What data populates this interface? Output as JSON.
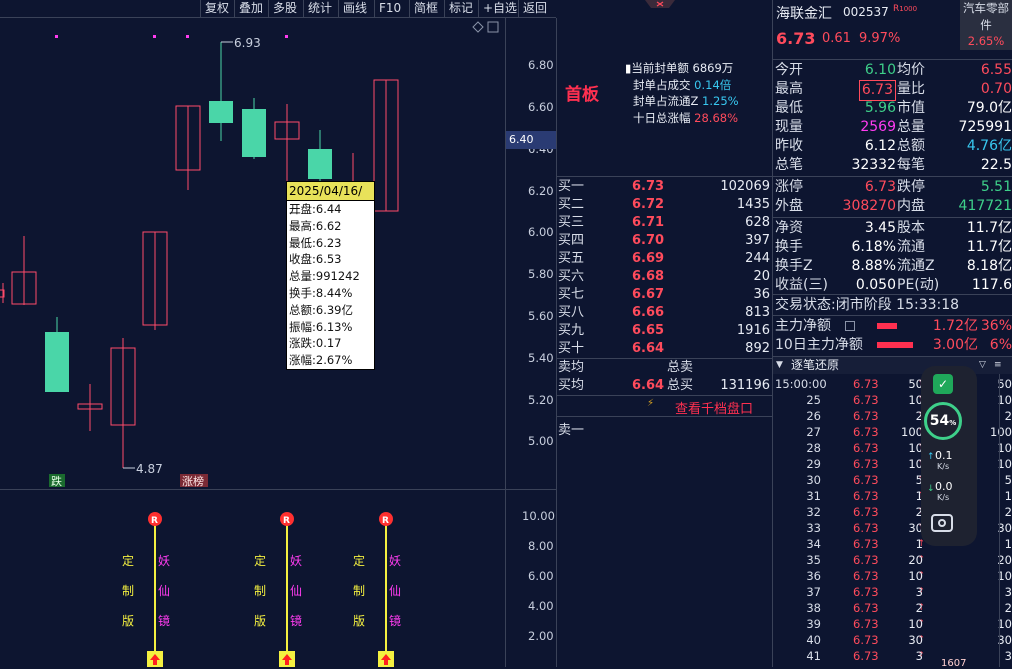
{
  "toolbar": {
    "items": [
      "复权",
      "叠加",
      "多股",
      "统计",
      "画线",
      "F10",
      "简框",
      "标记",
      "+自选",
      "返回"
    ]
  },
  "chart": {
    "high_label": "6.93",
    "low_label": "4.87",
    "price_axis": [
      "6.80",
      "6.60",
      "6.40",
      "6.20",
      "6.00",
      "5.80",
      "5.60",
      "5.40",
      "5.20",
      "5.00"
    ],
    "current_price_tag": "6.40",
    "badge_down": "跌",
    "badge_zhangting": "涨榜",
    "vol_axis": [
      "10.00",
      "8.00",
      "6.00",
      "4.00",
      "2.00"
    ],
    "indicator_marker": "R",
    "indicator_text_a": [
      "定",
      "制",
      "版"
    ],
    "indicator_text_b": [
      "妖",
      "仙",
      "镜"
    ],
    "colors": {
      "up": "#ff4b6a",
      "down": "#4ad6a8",
      "bg": "#0d1530",
      "grid": "#3a4258"
    }
  },
  "tooltip": {
    "date": "2025/04/16/三",
    "rows": [
      "开盘:6.44",
      "最高:6.62",
      "最低:6.23",
      "收盘:6.53",
      "总量:991242",
      "换手:8.44%",
      "总额:6.39亿",
      "振幅:6.13%",
      "涨跌:0.17",
      "涨幅:2.67%"
    ]
  },
  "board": {
    "title": "首板",
    "stats": [
      {
        "label": "当前封单额",
        "value": "6869万"
      },
      {
        "label": "封单占成交",
        "value": "0.14倍"
      },
      {
        "label": "封单占流通Z",
        "value": "1.25%"
      },
      {
        "label": "十日总涨幅",
        "value": "28.68%"
      }
    ]
  },
  "orderbook": {
    "bids": [
      {
        "label": "买一",
        "price": "6.73",
        "vol": "102069"
      },
      {
        "label": "买二",
        "price": "6.72",
        "vol": "1435"
      },
      {
        "label": "买三",
        "price": "6.71",
        "vol": "628"
      },
      {
        "label": "买四",
        "price": "6.70",
        "vol": "397"
      },
      {
        "label": "买五",
        "price": "6.69",
        "vol": "244"
      },
      {
        "label": "买六",
        "price": "6.68",
        "vol": "20"
      },
      {
        "label": "买七",
        "price": "6.67",
        "vol": "36"
      },
      {
        "label": "买八",
        "price": "6.66",
        "vol": "813"
      },
      {
        "label": "买九",
        "price": "6.65",
        "vol": "1916"
      },
      {
        "label": "买十",
        "price": "6.64",
        "vol": "892"
      }
    ],
    "sell_avg": "卖均",
    "total_sell": "总卖",
    "buy_avg": "买均",
    "buy_avg_price": "6.64",
    "total_buy": "总买",
    "total_buy_vol": "131196",
    "view_1000": "查看千档盘口",
    "ask1": "卖一"
  },
  "stock": {
    "name": "海联金汇",
    "code": "002537",
    "tag": "R",
    "tag2": "1000",
    "price": "6.73",
    "change": "0.61",
    "pct": "9.97%",
    "sector": "汽车零部件",
    "sector_pct": "2.65%"
  },
  "stats": [
    {
      "l1": "今开",
      "v1": "6.10",
      "c1": "green",
      "l2": "均价",
      "v2": "6.55",
      "c2": "red"
    },
    {
      "l1": "最高",
      "v1": "6.73",
      "c1": "red",
      "l2": "量比",
      "v2": "0.70",
      "c2": "red"
    },
    {
      "l1": "最低",
      "v1": "5.96",
      "c1": "green",
      "l2": "市值",
      "v2": "79.0亿",
      "c2": "white"
    },
    {
      "l1": "现量",
      "v1": "2569",
      "c1": "magenta",
      "l2": "总量",
      "v2": "725991",
      "c2": "white"
    },
    {
      "l1": "昨收",
      "v1": "6.12",
      "c1": "white",
      "l2": "总额",
      "v2": "4.76亿",
      "c2": "cyan"
    },
    {
      "l1": "总笔",
      "v1": "32332",
      "c1": "white",
      "l2": "每笔",
      "v2": "22.5",
      "c2": "white"
    },
    {
      "l1": "涨停",
      "v1": "6.73",
      "c1": "red",
      "l2": "跌停",
      "v2": "5.51",
      "c2": "green"
    },
    {
      "l1": "外盘",
      "v1": "308270",
      "c1": "red",
      "l2": "内盘",
      "v2": "417721",
      "c2": "green"
    },
    {
      "l1": "净资",
      "v1": "3.45",
      "c1": "white",
      "l2": "股本",
      "v2": "11.7亿",
      "c2": "white"
    },
    {
      "l1": "换手",
      "v1": "6.18%",
      "c1": "white",
      "l2": "流通",
      "v2": "11.7亿",
      "c2": "white"
    },
    {
      "l1": "换手Z",
      "v1": "8.88%",
      "c1": "white",
      "l2": "流通Z",
      "v2": "8.18亿",
      "c2": "white"
    },
    {
      "l1": "收益(三)",
      "v1": "0.050",
      "c1": "white",
      "l2": "PE(动)",
      "v2": "117.6",
      "c2": "white"
    }
  ],
  "status": {
    "label": "交易状态:",
    "value": "闭市阶段",
    "time": "15:33:18"
  },
  "netflow": [
    {
      "label": "主力净额",
      "value": "1.72亿",
      "pct": "36%"
    },
    {
      "label": "10日主力净额",
      "value": "3.00亿",
      "pct": "6%"
    }
  ],
  "ticks_title": "逐笔还原",
  "ticks": [
    {
      "t": "15:00:00",
      "p": "6.73",
      "v": "50"
    },
    {
      "t": "25",
      "p": "6.73",
      "v": "10"
    },
    {
      "t": "26",
      "p": "6.73",
      "v": "2"
    },
    {
      "t": "27",
      "p": "6.73",
      "v": "100"
    },
    {
      "t": "28",
      "p": "6.73",
      "v": "10"
    },
    {
      "t": "29",
      "p": "6.73",
      "v": "10"
    },
    {
      "t": "30",
      "p": "6.73",
      "v": "5"
    },
    {
      "t": "31",
      "p": "6.73",
      "v": "1"
    },
    {
      "t": "32",
      "p": "6.73",
      "v": "2"
    },
    {
      "t": "33",
      "p": "6.73",
      "v": "30"
    },
    {
      "t": "34",
      "p": "6.73",
      "v": "1"
    },
    {
      "t": "35",
      "p": "6.73",
      "v": "20"
    },
    {
      "t": "36",
      "p": "6.73",
      "v": "10"
    },
    {
      "t": "37",
      "p": "6.73",
      "v": "3"
    },
    {
      "t": "38",
      "p": "6.73",
      "v": "2"
    },
    {
      "t": "39",
      "p": "6.73",
      "v": "10"
    },
    {
      "t": "40",
      "p": "6.73",
      "v": "30"
    },
    {
      "t": "41",
      "p": "6.73",
      "v": "3"
    }
  ],
  "ticks_right": [
    "50",
    "10",
    "2",
    "100",
    "10",
    "10",
    "5",
    "1",
    "2",
    "30",
    "1",
    "20",
    "10",
    "3",
    "2",
    "10",
    "30",
    "3"
  ],
  "widget": {
    "speed": "54",
    "speed_unit": "%",
    "up_rate": "0.1",
    "down_rate": "0.0",
    "rate_unit": "K/s",
    "bar_value": "1607"
  }
}
